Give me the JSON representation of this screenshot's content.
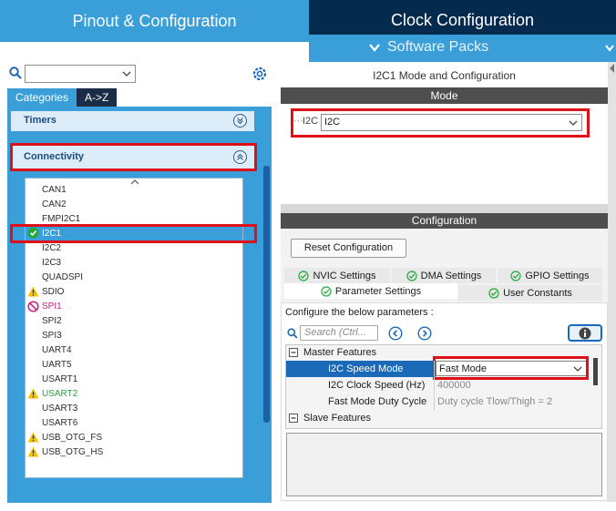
{
  "top_tabs": {
    "pinout": "Pinout & Configuration",
    "clock": "Clock Configuration"
  },
  "software_packs": "Software Packs",
  "search": {
    "value": ""
  },
  "category_tabs": [
    "Categories",
    "A->Z"
  ],
  "groups": {
    "timers": "Timers",
    "connectivity": "Connectivity"
  },
  "peripherals": [
    {
      "label": "CAN1",
      "status": "none"
    },
    {
      "label": "CAN2",
      "status": "none"
    },
    {
      "label": "FMPI2C1",
      "status": "none"
    },
    {
      "label": "I2C1",
      "status": "ok"
    },
    {
      "label": "I2C2",
      "status": "none"
    },
    {
      "label": "I2C3",
      "status": "none"
    },
    {
      "label": "QUADSPI",
      "status": "none"
    },
    {
      "label": "SDIO",
      "status": "warning"
    },
    {
      "label": "SPI1",
      "status": "blocked"
    },
    {
      "label": "SPI2",
      "status": "none"
    },
    {
      "label": "SPI3",
      "status": "none"
    },
    {
      "label": "UART4",
      "status": "none"
    },
    {
      "label": "UART5",
      "status": "none"
    },
    {
      "label": "USART1",
      "status": "none"
    },
    {
      "label": "USART2",
      "status": "warning"
    },
    {
      "label": "USART3",
      "status": "none"
    },
    {
      "label": "USART6",
      "status": "none"
    },
    {
      "label": "USB_OTG_FS",
      "status": "warning"
    },
    {
      "label": "USB_OTG_HS",
      "status": "warning"
    }
  ],
  "right": {
    "title": "I2C1 Mode and Configuration",
    "mode_header": "Mode",
    "mode_label": "I2C",
    "mode_value": "I2C",
    "config_header": "Configuration",
    "reset_button": "Reset Configuration",
    "tabs": [
      "NVIC Settings",
      "DMA Settings",
      "GPIO Settings",
      "Parameter Settings",
      "User Constants"
    ],
    "configure_text": "Configure the below parameters :",
    "param_search_placeholder": "Search (Ctrl...",
    "master_features": "Master Features",
    "params": [
      {
        "name": "I2C Speed Mode",
        "value": "Fast Mode"
      },
      {
        "name": "I2C Clock Speed (Hz)",
        "value": "400000"
      },
      {
        "name": "Fast Mode Duty Cycle",
        "value": "Duty cycle Tlow/Thigh = 2"
      }
    ],
    "slave_features": "Slave Features"
  },
  "colors": {
    "accent": "#3a9fd9",
    "dark_tab": "#042a4d",
    "highlight": "#e0101a",
    "ok": "#22a83a",
    "warning": "#f5c400",
    "blocked": "#d0197a",
    "usart2_text": "#2f9e44"
  }
}
